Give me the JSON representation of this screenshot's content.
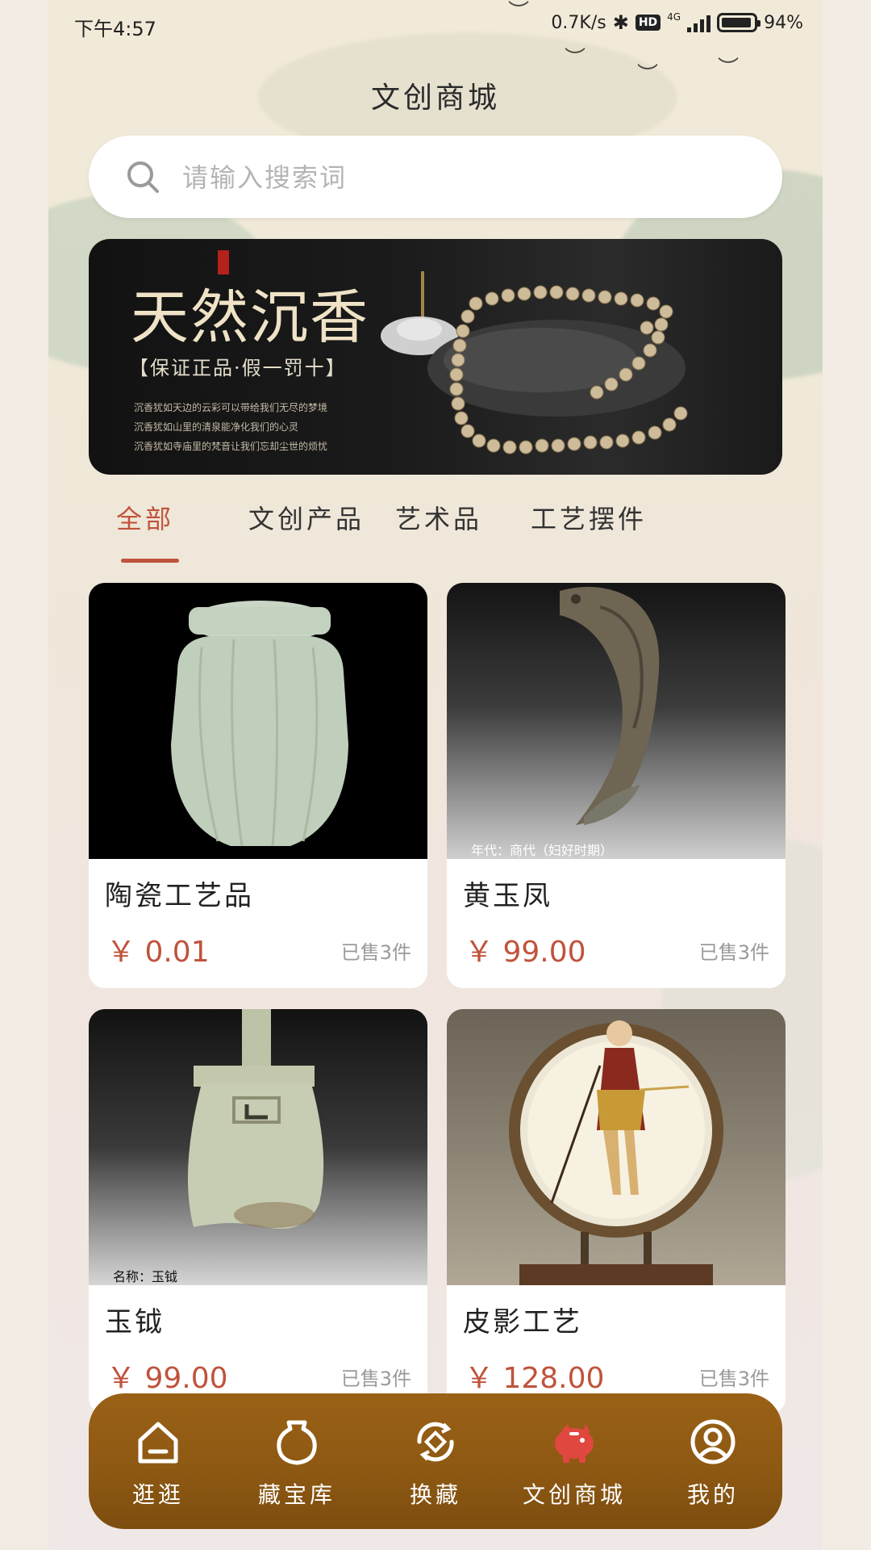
{
  "status_bar": {
    "time": "下午4:57",
    "network_speed": "0.7K/s",
    "hd_badge": "HD",
    "network_type": "4G",
    "battery": "94%",
    "battery_level": 0.94
  },
  "page": {
    "title": "文创商城"
  },
  "search": {
    "placeholder": "请输入搜索词"
  },
  "banner": {
    "title": "天然沉香",
    "subtitle": "【保证正品·假一罚十】",
    "lines": [
      "沉香犹如天边的云彩可以带给我们无尽的梦境",
      "沉香犹如山里的清泉能净化我们的心灵",
      "沉香犹如寺庙里的梵音让我们忘却尘世的烦忧"
    ]
  },
  "tabs": [
    {
      "label": "全部",
      "active": true
    },
    {
      "label": "文创产品",
      "active": false
    },
    {
      "label": "艺术品",
      "active": false
    },
    {
      "label": "工艺摆件",
      "active": false
    }
  ],
  "products": [
    {
      "name": "陶瓷工艺品",
      "price": "￥ 0.01",
      "sold": "已售3件",
      "caption": ""
    },
    {
      "name": "黄玉凤",
      "price": "￥ 99.00",
      "sold": "已售3件",
      "caption": "年代：商代（妇好时期）"
    },
    {
      "name": "玉钺",
      "price": "￥ 99.00",
      "sold": "已售3件",
      "caption": "名称：玉钺"
    },
    {
      "name": "皮影工艺",
      "price": "￥ 128.00",
      "sold": "已售3件",
      "caption": ""
    }
  ],
  "bottom_nav": [
    {
      "label": "逛逛",
      "icon": "home-icon"
    },
    {
      "label": "藏宝库",
      "icon": "vase-icon"
    },
    {
      "label": "换藏",
      "icon": "exchange-icon"
    },
    {
      "label": "文创商城",
      "icon": "piggy-bank-icon"
    },
    {
      "label": "我的",
      "icon": "user-icon"
    }
  ],
  "colors": {
    "accent": "#c0533c",
    "nav_bg": "#8e5913",
    "active_nav_icon": "#e0473f"
  }
}
